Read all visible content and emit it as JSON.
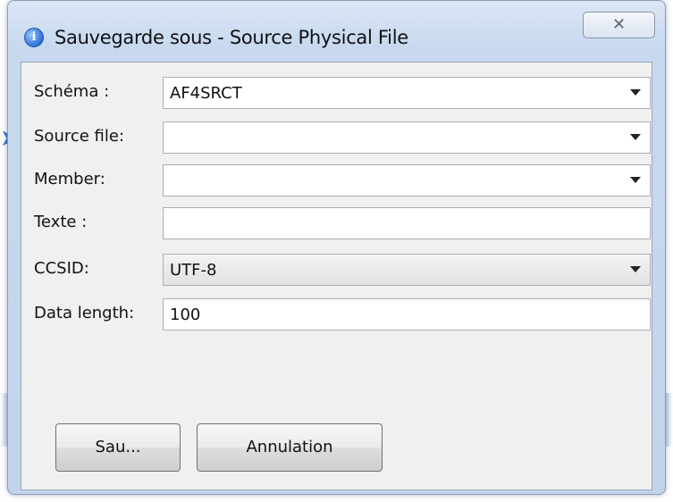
{
  "window": {
    "title": "Sauvegarde sous - Source Physical File",
    "close_glyph": "✕"
  },
  "form": {
    "fields": [
      {
        "label": "Schéma :",
        "value": "AF4SRCT",
        "type": "combo"
      },
      {
        "label": "Source file:",
        "value": "",
        "type": "combo"
      },
      {
        "label": "Member:",
        "value": "",
        "type": "combo"
      },
      {
        "label": "Texte :",
        "value": "",
        "type": "text"
      },
      {
        "label": "CCSID:",
        "value": "UTF-8",
        "type": "combo-readonly"
      },
      {
        "label": "Data length:",
        "value": "100",
        "type": "text"
      }
    ]
  },
  "buttons": {
    "save_label": "Sau...",
    "cancel_label": "Annulation"
  },
  "colors": {
    "title_gradient_top": "#dbe7f6",
    "client_bg": "#f0f0f0",
    "accent_arrow": "#2f6fd6"
  },
  "icons": {
    "title": "info-icon",
    "close": "close-icon",
    "dropdown": "chevron-down-icon"
  }
}
